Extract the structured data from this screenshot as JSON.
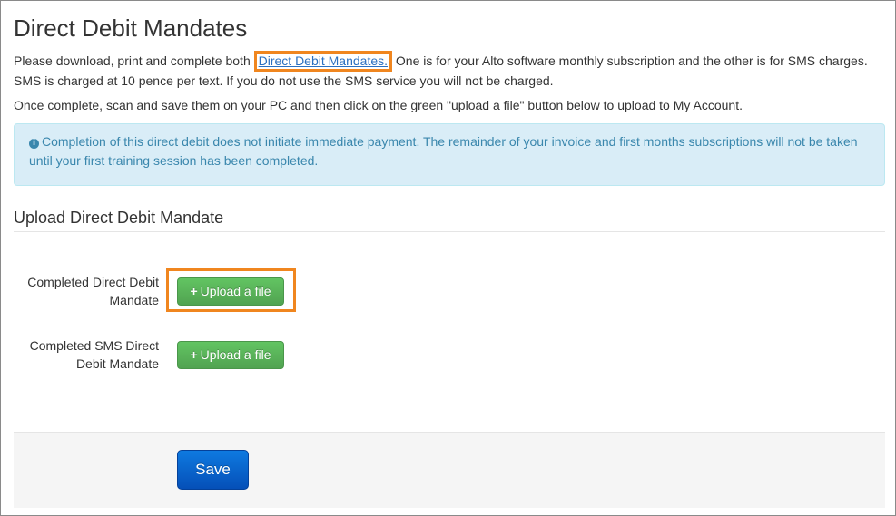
{
  "page": {
    "title": "Direct Debit Mandates"
  },
  "intro": {
    "text_before_link": "Please download, print and complete both ",
    "link_text": "Direct Debit Mandates.",
    "text_after_link": " One is for your Alto software monthly subscription and the other is for SMS charges. SMS is charged at 10 pence per text. If you do not use the SMS service you will not be charged.",
    "instructions": "Once complete, scan and save them on your PC and then click on the green \"upload a file\" button below to upload to My Account."
  },
  "alert": {
    "icon": "info-icon",
    "text": "Completion of this direct debit does not initiate immediate payment. The remainder of your invoice and first months subscriptions will not be taken until your first training session has been completed."
  },
  "upload_section": {
    "title": "Upload Direct Debit Mandate",
    "fields": [
      {
        "label": "Completed Direct Debit Mandate",
        "button_label": "Upload a file",
        "button_icon": "+"
      },
      {
        "label": "Completed SMS Direct Debit Mandate",
        "button_label": "Upload a file",
        "button_icon": "+"
      }
    ]
  },
  "footer": {
    "save_label": "Save"
  },
  "colors": {
    "highlight": "#f0861f",
    "upload_button": "#5cb85c",
    "save_button": "#0a63cc",
    "alert_bg": "#d9edf7",
    "alert_text": "#3a87ad",
    "link": "#2a6fc0"
  }
}
